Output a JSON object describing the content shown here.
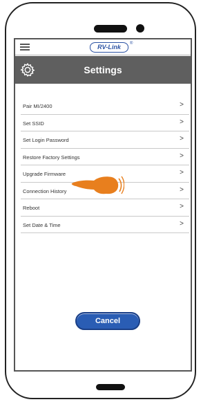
{
  "header": {
    "logo_text": "RV-Link",
    "logo_mark": "®",
    "title": "Settings"
  },
  "menu": {
    "items": [
      {
        "label": "Pair MI/2400"
      },
      {
        "label": "Set SSID"
      },
      {
        "label": "Set Login Password"
      },
      {
        "label": "Restore Factory Settings"
      },
      {
        "label": "Upgrade Firmware"
      },
      {
        "label": "Connection History"
      },
      {
        "label": "Reboot"
      },
      {
        "label": "Set Date & Time"
      }
    ],
    "chevron": ">"
  },
  "footer": {
    "cancel_label": "Cancel"
  },
  "colors": {
    "title_bar": "#5f5f5f",
    "brand_blue": "#2b52a3",
    "cancel_button": "#2a5db4",
    "pointer_hand": "#e87f1e"
  },
  "icons": [
    "hamburger-menu-icon",
    "gear-icon",
    "chevron-right-icon",
    "pointing-hand-icon"
  ]
}
